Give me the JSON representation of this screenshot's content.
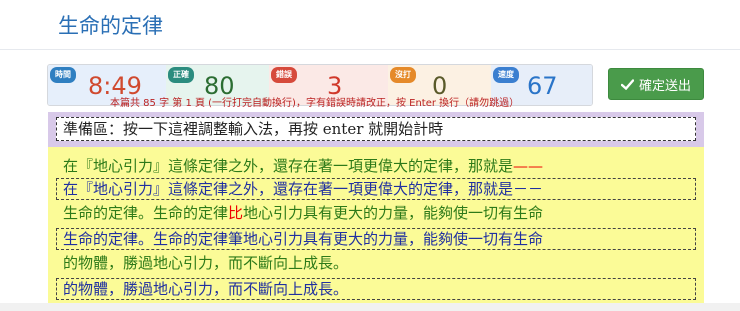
{
  "page": {
    "title": "生命的定律"
  },
  "stats": [
    {
      "key": "time",
      "label": "時間",
      "value": "8:49",
      "label_color": "#2f7fc1",
      "value_color": "#d0492e",
      "bg": "#e6effb"
    },
    {
      "key": "correct",
      "label": "正確",
      "value": "80",
      "label_color": "#2b8c7f",
      "value_color": "#2b6d32",
      "bg": "#e6f4ee"
    },
    {
      "key": "error",
      "label": "錯誤",
      "value": "3",
      "label_color": "#d64a3c",
      "value_color": "#d0382a",
      "bg": "#fbe9e6"
    },
    {
      "key": "missed",
      "label": "沒打",
      "value": "0",
      "label_color": "#e58a2a",
      "value_color": "#5a5a2a",
      "bg": "#fcf1e3"
    },
    {
      "key": "speed",
      "label": "速度",
      "value": "67",
      "label_color": "#3b7fd0",
      "value_color": "#2a74c8",
      "bg": "#e7eef9"
    }
  ],
  "hint_text": "本篇共 85 字 第 1 頁 (一行打完自動換行)，字有錯誤時請改正，按 Enter 換行（請勿跳過）",
  "submit_label": "確定送出",
  "prep": {
    "text": "準備區：按一下這裡調整輸入法，再按 enter 就開始計時"
  },
  "lines": [
    {
      "source_before": "在『地心引力』這條定律之外，還存在著一項更偉大的定律，那就是",
      "source_err": "",
      "source_after": "——",
      "input": "在『地心引力』這條定律之外，還存在著一項更偉大的定律，那就是－－"
    },
    {
      "source_before": "生命的定律。生命的定律",
      "source_err": "比",
      "source_after": "地心引力具有更大的力量，能夠使一切有生命",
      "input": "生命的定律。生命的定律筆地心引力具有更大的力量，能夠使一切有生命"
    },
    {
      "source_before": "的物體，勝過地心引力，而不斷向上成長。",
      "source_err": "",
      "source_after": "",
      "input": "的物體，勝過地心引力，而不斷向上成長。"
    }
  ]
}
